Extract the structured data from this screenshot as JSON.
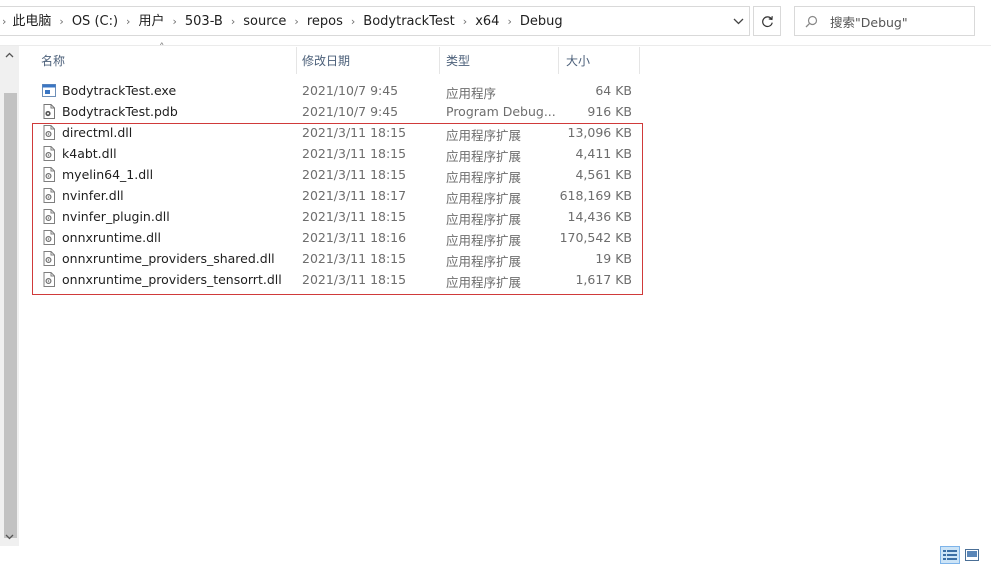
{
  "address": {
    "segments": [
      "此电脑",
      "OS (C:)",
      "用户",
      "503-B",
      "source",
      "repos",
      "BodytrackTest",
      "x64",
      "Debug"
    ]
  },
  "search": {
    "placeholder": "搜索\"Debug\""
  },
  "columns": {
    "name": "名称",
    "date": "修改日期",
    "type": "类型",
    "size": "大小"
  },
  "files": [
    {
      "name": "BodytrackTest.exe",
      "date": "2021/10/7 9:45",
      "type": "应用程序",
      "size": "64 KB",
      "icon": "exe-icon"
    },
    {
      "name": "BodytrackTest.pdb",
      "date": "2021/10/7 9:45",
      "type": "Program Debug...",
      "size": "916 KB",
      "icon": "pdb-icon"
    },
    {
      "name": "directml.dll",
      "date": "2021/3/11 18:15",
      "type": "应用程序扩展",
      "size": "13,096 KB",
      "icon": "dll-icon"
    },
    {
      "name": "k4abt.dll",
      "date": "2021/3/11 18:15",
      "type": "应用程序扩展",
      "size": "4,411 KB",
      "icon": "dll-icon"
    },
    {
      "name": "myelin64_1.dll",
      "date": "2021/3/11 18:15",
      "type": "应用程序扩展",
      "size": "4,561 KB",
      "icon": "dll-icon"
    },
    {
      "name": "nvinfer.dll",
      "date": "2021/3/11 18:17",
      "type": "应用程序扩展",
      "size": "618,169 KB",
      "icon": "dll-icon"
    },
    {
      "name": "nvinfer_plugin.dll",
      "date": "2021/3/11 18:15",
      "type": "应用程序扩展",
      "size": "14,436 KB",
      "icon": "dll-icon"
    },
    {
      "name": "onnxruntime.dll",
      "date": "2021/3/11 18:16",
      "type": "应用程序扩展",
      "size": "170,542 KB",
      "icon": "dll-icon"
    },
    {
      "name": "onnxruntime_providers_shared.dll",
      "date": "2021/3/11 18:15",
      "type": "应用程序扩展",
      "size": "19 KB",
      "icon": "dll-icon"
    },
    {
      "name": "onnxruntime_providers_tensorrt.dll",
      "date": "2021/3/11 18:15",
      "type": "应用程序扩展",
      "size": "1,617 KB",
      "icon": "dll-icon"
    }
  ],
  "colors": {
    "highlight_border": "#d03a3a",
    "header_text": "#4c607a",
    "selected_view": "#cce4f7"
  }
}
